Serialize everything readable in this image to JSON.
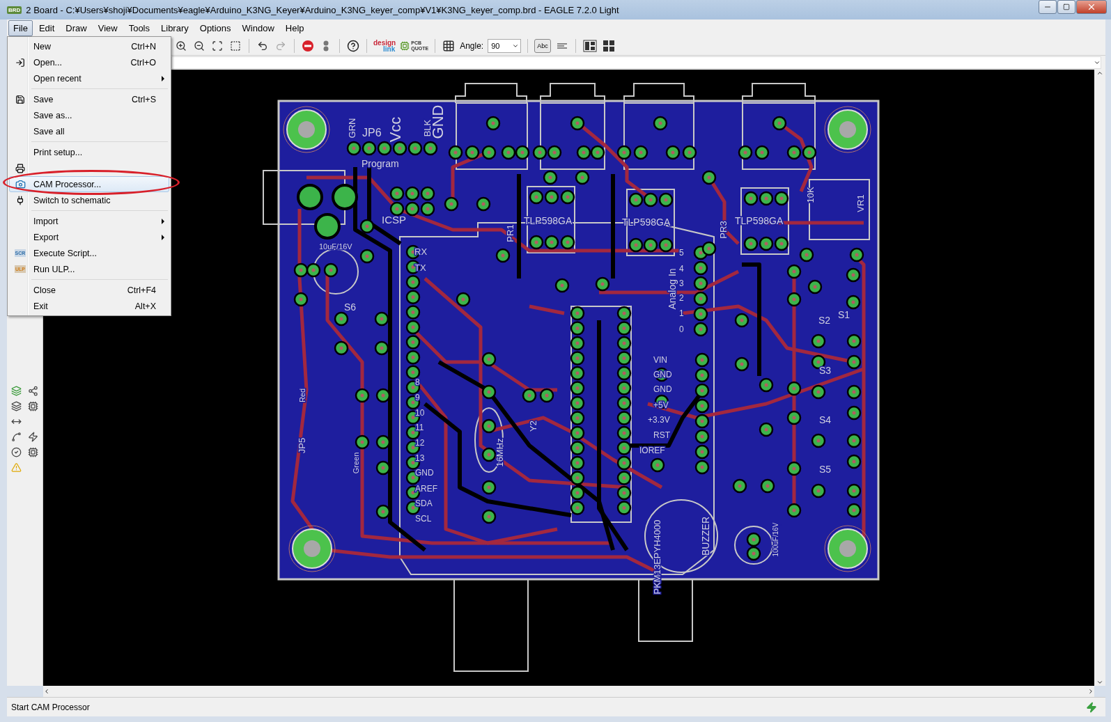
{
  "window": {
    "app_badge": "BRD",
    "title": "2 Board - C:¥Users¥shoji¥Documents¥eagle¥Arduino_K3NG_Keyer¥Arduino_K3NG_keyer_comp¥V1¥K3NG_keyer_comp.brd - EAGLE 7.2.0 Light"
  },
  "menubar": [
    {
      "label": "File",
      "selected": true
    },
    {
      "label": "Edit",
      "selected": false
    },
    {
      "label": "Draw",
      "selected": false
    },
    {
      "label": "View",
      "selected": false
    },
    {
      "label": "Tools",
      "selected": false
    },
    {
      "label": "Library",
      "selected": false
    },
    {
      "label": "Options",
      "selected": false
    },
    {
      "label": "Window",
      "selected": false
    },
    {
      "label": "Help",
      "selected": false
    }
  ],
  "file_menu": [
    {
      "kind": "item",
      "label": "New",
      "shortcut": "Ctrl+N",
      "selected": false
    },
    {
      "kind": "item",
      "label": "Open...",
      "shortcut": "Ctrl+O",
      "selected": false
    },
    {
      "kind": "submenu",
      "label": "Open recent",
      "selected": false
    },
    {
      "kind": "separator"
    },
    {
      "kind": "item",
      "label": "Save",
      "shortcut": "Ctrl+S",
      "selected": false
    },
    {
      "kind": "item",
      "label": "Save as...",
      "selected": false
    },
    {
      "kind": "item",
      "label": "Save all",
      "selected": false
    },
    {
      "kind": "separator"
    },
    {
      "kind": "item",
      "label": "Print setup...",
      "selected": false
    },
    {
      "kind": "covered"
    },
    {
      "kind": "item",
      "label": "CAM Processor...",
      "selected": true
    },
    {
      "kind": "item",
      "label": "Switch to schematic",
      "selected": false
    },
    {
      "kind": "separator"
    },
    {
      "kind": "submenu",
      "label": "Import",
      "selected": false
    },
    {
      "kind": "submenu",
      "label": "Export",
      "selected": false
    },
    {
      "kind": "item",
      "label": "Execute Script...",
      "badge": "SCR",
      "selected": false
    },
    {
      "kind": "item",
      "label": "Run ULP...",
      "badge": "ULP",
      "selected": false
    },
    {
      "kind": "separator"
    },
    {
      "kind": "item",
      "label": "Close",
      "shortcut": "Ctrl+F4",
      "selected": false
    },
    {
      "kind": "item",
      "label": "Exit",
      "shortcut": "Alt+X",
      "selected": false
    }
  ],
  "toolbar": {
    "design_logo": [
      "design",
      "link"
    ],
    "quote_logo": [
      "PCB",
      "QUOTE"
    ],
    "angle_label": "Angle:",
    "angle_value": "90",
    "text_button": "Abc"
  },
  "board": {
    "labels": [
      {
        "text": "JP6",
        "kind": "horizontal"
      },
      {
        "text": "GRN",
        "kind": "vertical"
      },
      {
        "text": "Vcc",
        "kind": "vertical"
      },
      {
        "text": "BLK",
        "kind": "vertical"
      },
      {
        "text": "GND",
        "kind": "vertical"
      },
      {
        "text": "Program",
        "kind": "horizontal"
      },
      {
        "text": "ICSP",
        "kind": "horizontal"
      },
      {
        "text": "10uF/16V",
        "kind": "horizontal"
      },
      {
        "text": "S6",
        "kind": "horizontal"
      },
      {
        "text": "RX",
        "kind": "horizontal"
      },
      {
        "text": "TX",
        "kind": "horizontal"
      },
      {
        "text": "8",
        "kind": "horizontal"
      },
      {
        "text": "9",
        "kind": "horizontal"
      },
      {
        "text": "10",
        "kind": "horizontal"
      },
      {
        "text": "11",
        "kind": "horizontal"
      },
      {
        "text": "12",
        "kind": "horizontal"
      },
      {
        "text": "13",
        "kind": "horizontal"
      },
      {
        "text": "GND",
        "kind": "horizontal"
      },
      {
        "text": "AREF",
        "kind": "horizontal"
      },
      {
        "text": "SDA",
        "kind": "horizontal"
      },
      {
        "text": "SCL",
        "kind": "horizontal"
      },
      {
        "text": "Analog In",
        "kind": "vertical"
      },
      {
        "text": "5",
        "kind": "horizontal"
      },
      {
        "text": "4",
        "kind": "horizontal"
      },
      {
        "text": "3",
        "kind": "horizontal"
      },
      {
        "text": "2",
        "kind": "horizontal"
      },
      {
        "text": "1",
        "kind": "horizontal"
      },
      {
        "text": "0",
        "kind": "horizontal"
      },
      {
        "text": "VIN",
        "kind": "horizontal"
      },
      {
        "text": "GND",
        "kind": "horizontal"
      },
      {
        "text": "GND",
        "kind": "horizontal"
      },
      {
        "text": "+5V",
        "kind": "horizontal"
      },
      {
        "text": "+3.3V",
        "kind": "horizontal"
      },
      {
        "text": "RST",
        "kind": "horizontal"
      },
      {
        "text": "IOREF",
        "kind": "horizontal"
      },
      {
        "text": "TLP598GA",
        "kind": "horizontal"
      },
      {
        "text": "TLP598GA",
        "kind": "horizontal"
      },
      {
        "text": "TLP598GA",
        "kind": "horizontal"
      },
      {
        "text": "16MHz",
        "kind": "vertical"
      },
      {
        "text": "Y2",
        "kind": "vertical"
      },
      {
        "text": "BUZZER",
        "kind": "vertical"
      },
      {
        "text": "PKM13EPYH4000",
        "kind": "vertical"
      },
      {
        "text": "S1",
        "kind": "horizontal"
      },
      {
        "text": "S2",
        "kind": "horizontal"
      },
      {
        "text": "S3",
        "kind": "horizontal"
      },
      {
        "text": "S4",
        "kind": "horizontal"
      },
      {
        "text": "S5",
        "kind": "horizontal"
      },
      {
        "text": "10K",
        "kind": "vertical"
      },
      {
        "text": "VR1",
        "kind": "vertical"
      },
      {
        "text": "100uF/16V",
        "kind": "vertical"
      },
      {
        "text": "JP5",
        "kind": "vertical"
      },
      {
        "text": "Red",
        "kind": "vertical"
      },
      {
        "text": "Green",
        "kind": "vertical"
      },
      {
        "text": "PR1",
        "kind": "vertical"
      },
      {
        "text": "PR3",
        "kind": "vertical"
      }
    ]
  },
  "status_bar": {
    "text": "Start CAM Processor"
  }
}
